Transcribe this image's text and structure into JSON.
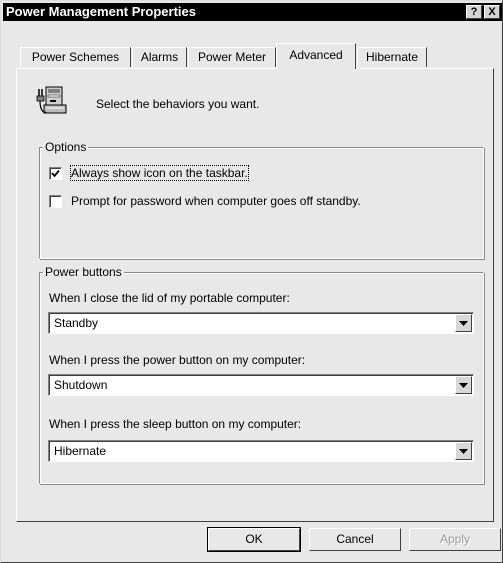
{
  "window": {
    "title": "Power Management Properties"
  },
  "caption_buttons": {
    "help": "?",
    "close": "X"
  },
  "tabs": [
    {
      "label": "Power Schemes"
    },
    {
      "label": "Alarms"
    },
    {
      "label": "Power Meter"
    },
    {
      "label": "Advanced"
    },
    {
      "label": "Hibernate"
    }
  ],
  "active_tab": "Advanced",
  "header": {
    "text": "Select the behaviors you want.",
    "icon": "computer-with-power-plug-icon"
  },
  "options": {
    "legend": "Options",
    "show_icon": {
      "label": "Always show icon on the taskbar.",
      "checked": true
    },
    "prompt_password": {
      "label": "Prompt for password when computer goes off standby.",
      "checked": false
    }
  },
  "power_buttons": {
    "legend": "Power buttons",
    "lid": {
      "label": "When I close the lid of my portable computer:",
      "value": "Standby"
    },
    "power": {
      "label": "When I press the power button on my computer:",
      "value": "Shutdown"
    },
    "sleep": {
      "label": "When I press the sleep button on my computer:",
      "value": "Hibernate"
    }
  },
  "buttons": {
    "ok": "OK",
    "cancel": "Cancel",
    "apply": "Apply"
  },
  "colors": {
    "title_bar": "#000000",
    "face": "#e8e8e8",
    "field": "#ffffff"
  }
}
